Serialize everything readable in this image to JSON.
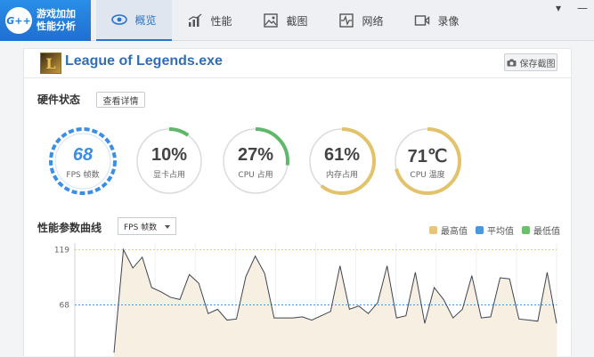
{
  "app": {
    "logo_badge": "G++",
    "logo_line1": "游戏加加",
    "logo_line2": "性能分析"
  },
  "tabs": [
    {
      "label": "概览",
      "icon": "eye-icon",
      "active": true
    },
    {
      "label": "性能",
      "icon": "bar-chart-icon"
    },
    {
      "label": "截图",
      "icon": "image-icon"
    },
    {
      "label": "网络",
      "icon": "pulse-icon"
    },
    {
      "label": "录像",
      "icon": "video-icon"
    }
  ],
  "window": {
    "minimize": "▾",
    "close": "—"
  },
  "game": {
    "title": "League of Legends.exe",
    "icon_letter": "L"
  },
  "header": {
    "screenshot_label": "保存截图"
  },
  "hardware": {
    "title": "硬件状态",
    "detail_button": "查看详情"
  },
  "gauges": [
    {
      "value": "68",
      "label": "FPS 帧数",
      "percent": null,
      "color": "#3a8ee6"
    },
    {
      "value": "10%",
      "label": "显卡占用",
      "percent": 10,
      "color": "#5fb86a"
    },
    {
      "value": "27%",
      "label": "CPU 占用",
      "percent": 27,
      "color": "#5fb86a"
    },
    {
      "value": "61%",
      "label": "内存占用",
      "percent": 61,
      "color": "#e2c26a"
    },
    {
      "value": "71℃",
      "label": "CPU 温度",
      "percent": 71,
      "color": "#e2c26a"
    }
  ],
  "perf_chart": {
    "title": "性能参数曲线",
    "selected_metric": "FPS 帧数",
    "legend": [
      {
        "label": "最高值",
        "color": "#e8c57a"
      },
      {
        "label": "平均值",
        "color": "#4a97e0"
      },
      {
        "label": "最低值",
        "color": "#6cbf6c"
      }
    ]
  },
  "chart_data": {
    "type": "line",
    "series": [
      {
        "values": [
          24,
          119,
          102,
          112,
          84,
          80,
          75,
          73,
          96,
          88,
          60,
          64,
          54,
          55,
          94,
          113,
          97,
          56,
          56,
          56,
          57,
          54,
          58,
          62,
          104,
          64,
          67,
          60,
          70,
          104,
          56,
          58,
          98,
          51,
          84,
          73,
          56,
          64,
          95,
          56,
          57,
          93,
          92,
          55,
          54,
          53,
          98,
          51
        ]
      }
    ],
    "yticks": [
      119,
      68
    ],
    "max_line": 119,
    "avg_line": 68,
    "ylim": [
      20,
      125
    ]
  }
}
